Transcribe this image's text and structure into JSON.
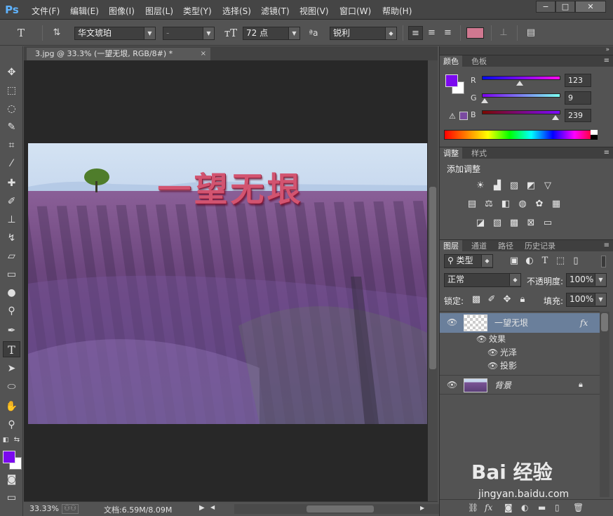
{
  "app": {
    "logo": "Ps"
  },
  "menu": [
    "文件(F)",
    "编辑(E)",
    "图像(I)",
    "图层(L)",
    "类型(Y)",
    "选择(S)",
    "滤镜(T)",
    "视图(V)",
    "窗口(W)",
    "帮助(H)"
  ],
  "window_controls": {
    "minimize": "−",
    "maximize": "□",
    "close": "✕"
  },
  "options_bar": {
    "font_family": "华文琥珀",
    "font_style": "-",
    "font_size": "72 点",
    "antialias_icon_label": "ªa",
    "antialias": "锐利",
    "text_color": "#d07890"
  },
  "document": {
    "tab_title": "3.jpg @ 33.3% (一望无垠, RGB/8#) *",
    "tab_close": "×",
    "overlay_text": "一望无垠",
    "zoom": "33.33%",
    "doc_size": "文档:6.59M/8.09M"
  },
  "color_panel": {
    "tabs": [
      "颜色",
      "色板"
    ],
    "foreground": "#7b09ef",
    "background": "#ffffff",
    "r_label": "R",
    "g_label": "G",
    "b_label": "B",
    "r": 123,
    "g": 9,
    "b": 239,
    "r_value": "123",
    "g_value": "9",
    "b_value": "239"
  },
  "adjustments_panel": {
    "tabs": [
      "调整",
      "样式"
    ],
    "title": "添加调整"
  },
  "layers_panel": {
    "tabs": [
      "图层",
      "通道",
      "路径",
      "历史记录"
    ],
    "filter_kind": "类型",
    "blend_mode": "正常",
    "opacity_label": "不透明度:",
    "opacity": "100%",
    "lock_label": "锁定:",
    "fill_label": "填充:",
    "fill": "100%",
    "layers": [
      {
        "name": "一望无垠",
        "fx": "fx",
        "selected": true
      },
      {
        "name": "背景",
        "locked": true
      }
    ],
    "effects_label": "效果",
    "effects": [
      "光泽",
      "投影"
    ]
  },
  "watermark": {
    "logo": "Bai 经验",
    "url": "jingyan.baidu.com"
  }
}
